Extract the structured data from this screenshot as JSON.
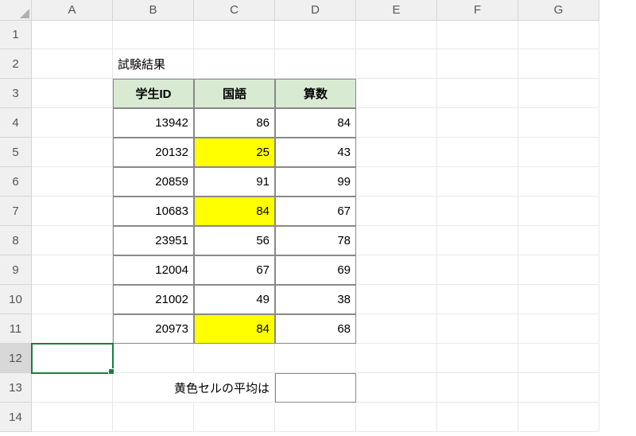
{
  "columns": [
    "A",
    "B",
    "C",
    "D",
    "E",
    "F",
    "G"
  ],
  "rows": [
    "1",
    "2",
    "3",
    "4",
    "5",
    "6",
    "7",
    "8",
    "9",
    "10",
    "11",
    "12",
    "13",
    "14"
  ],
  "title": "試験結果",
  "headers": {
    "id": "学生ID",
    "japanese": "国語",
    "math": "算数"
  },
  "data": [
    {
      "id": "13942",
      "japanese": "86",
      "math": "84",
      "highlight": false
    },
    {
      "id": "20132",
      "japanese": "25",
      "math": "43",
      "highlight": true
    },
    {
      "id": "20859",
      "japanese": "91",
      "math": "99",
      "highlight": false
    },
    {
      "id": "10683",
      "japanese": "84",
      "math": "67",
      "highlight": true
    },
    {
      "id": "23951",
      "japanese": "56",
      "math": "78",
      "highlight": false
    },
    {
      "id": "12004",
      "japanese": "67",
      "math": "69",
      "highlight": false
    },
    {
      "id": "21002",
      "japanese": "49",
      "math": "38",
      "highlight": false
    },
    {
      "id": "20973",
      "japanese": "84",
      "math": "68",
      "highlight": true
    }
  ],
  "average_label": "黄色セルの平均は",
  "average_value": "",
  "active_cell": "A12",
  "chart_data": {
    "type": "table",
    "title": "試験結果",
    "columns": [
      "学生ID",
      "国語",
      "算数"
    ],
    "rows": [
      [
        13942,
        86,
        84
      ],
      [
        20132,
        25,
        43
      ],
      [
        20859,
        91,
        99
      ],
      [
        10683,
        84,
        67
      ],
      [
        23951,
        56,
        78
      ],
      [
        12004,
        67,
        69
      ],
      [
        21002,
        49,
        38
      ],
      [
        20973,
        84,
        68
      ]
    ],
    "highlighted_rows_japanese": [
      25,
      84,
      84
    ]
  }
}
